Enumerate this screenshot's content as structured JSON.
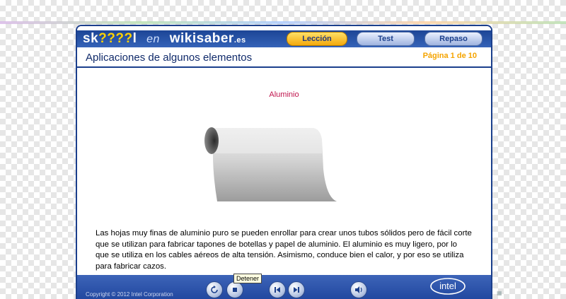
{
  "logo": {
    "skool": "sk",
    "skool_q": "????",
    "skool_end": "l",
    "en": "en",
    "wiki": "wikisaber",
    "es": ".es"
  },
  "tabs": {
    "leccion": "Lección",
    "test": "Test",
    "repaso": "Repaso"
  },
  "header": {
    "title": "Aplicaciones de algunos elementos",
    "page": "Página 1 de 10"
  },
  "content": {
    "caption": "Aluminio",
    "paragraph": "Las hojas muy finas de aluminio puro se pueden enrollar para crear unos tubos sólidos pero de fácil corte que se utilizan para fabricar tapones de botellas y papel de aluminio. El aluminio es muy ligero, por lo que se utiliza en los cables aéreos de alta tensión. Asimismo, conduce bien el calor, y por eso se utiliza para fabricar cazos."
  },
  "footer": {
    "copyright": "Copyright © 2012 Intel Corporation",
    "tooltip": "Detener",
    "intel": "intel"
  },
  "colors": {
    "brand_blue": "#1b3f8c",
    "accent_orange": "#f5a400",
    "caption_red": "#c0144d"
  }
}
